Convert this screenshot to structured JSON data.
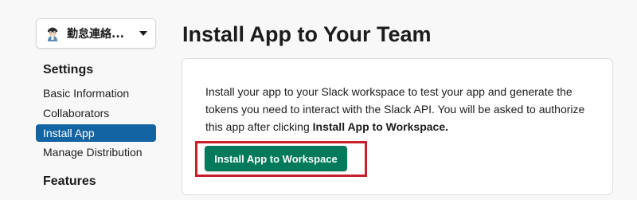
{
  "sidebar": {
    "app_selector": {
      "name": "勤怠連絡..."
    },
    "settings_title": "Settings",
    "items": [
      {
        "label": "Basic Information"
      },
      {
        "label": "Collaborators"
      },
      {
        "label": "Install App",
        "active": true
      },
      {
        "label": "Manage Distribution"
      }
    ],
    "features_title": "Features"
  },
  "main": {
    "title": "Install App to Your Team",
    "description_prefix": "Install your app to your Slack workspace to test your app and generate the tokens you need to interact with the Slack API. You will be asked to authorize this app after clicking ",
    "description_bold": "Install App to Workspace.",
    "install_button_label": "Install App to Workspace"
  },
  "colors": {
    "active_nav_bg": "#1264a3",
    "install_button_bg": "#007a5a",
    "highlight_border": "#c8202b"
  },
  "icons": {
    "app_avatar": "app-avatar-icon",
    "dropdown": "chevron-down-icon"
  }
}
